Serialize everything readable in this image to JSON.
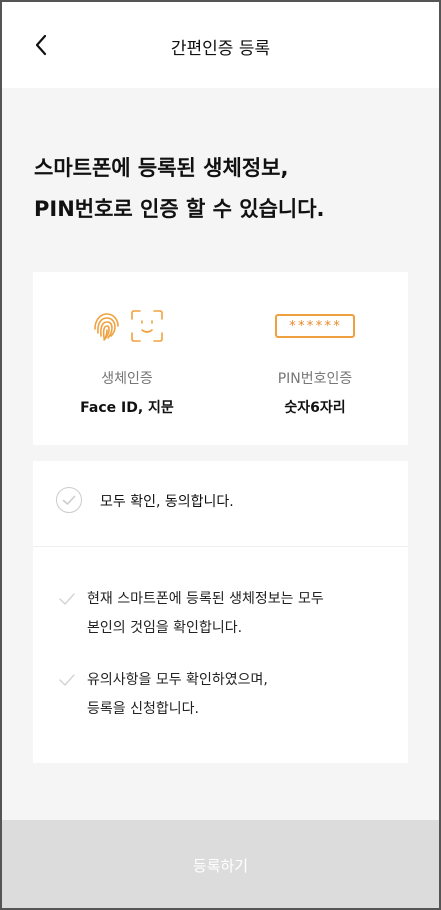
{
  "header": {
    "back_icon": "chevron-left-icon",
    "title": "간편인증 등록"
  },
  "headline": {
    "line1": "스마트폰에 등록된 생체정보,",
    "line2": "PIN번호로 인증 할 수 있습니다."
  },
  "methods": [
    {
      "icon": "fingerprint-face-id-icon",
      "label": "생체인증",
      "value": "Face ID, 지문"
    },
    {
      "icon": "pin-code-icon",
      "pin_mask": "******",
      "label": "PIN번호인증",
      "value": "숫자6자리"
    }
  ],
  "agreement": {
    "all_label": "모두 확인, 동의합니다.",
    "items": [
      {
        "line1": "현재 스마트폰에 등록된 생체정보는 모두",
        "line2": "본인의 것임을 확인합니다."
      },
      {
        "line1": "유의사항을 모두 확인하였으며,",
        "line2": "등록을 신청합니다."
      }
    ]
  },
  "submit": {
    "label": "등록하기",
    "enabled": false
  },
  "colors": {
    "accent": "#f0a13f",
    "disabled_button": "#dcdcdc",
    "background": "#f5f5f5"
  }
}
